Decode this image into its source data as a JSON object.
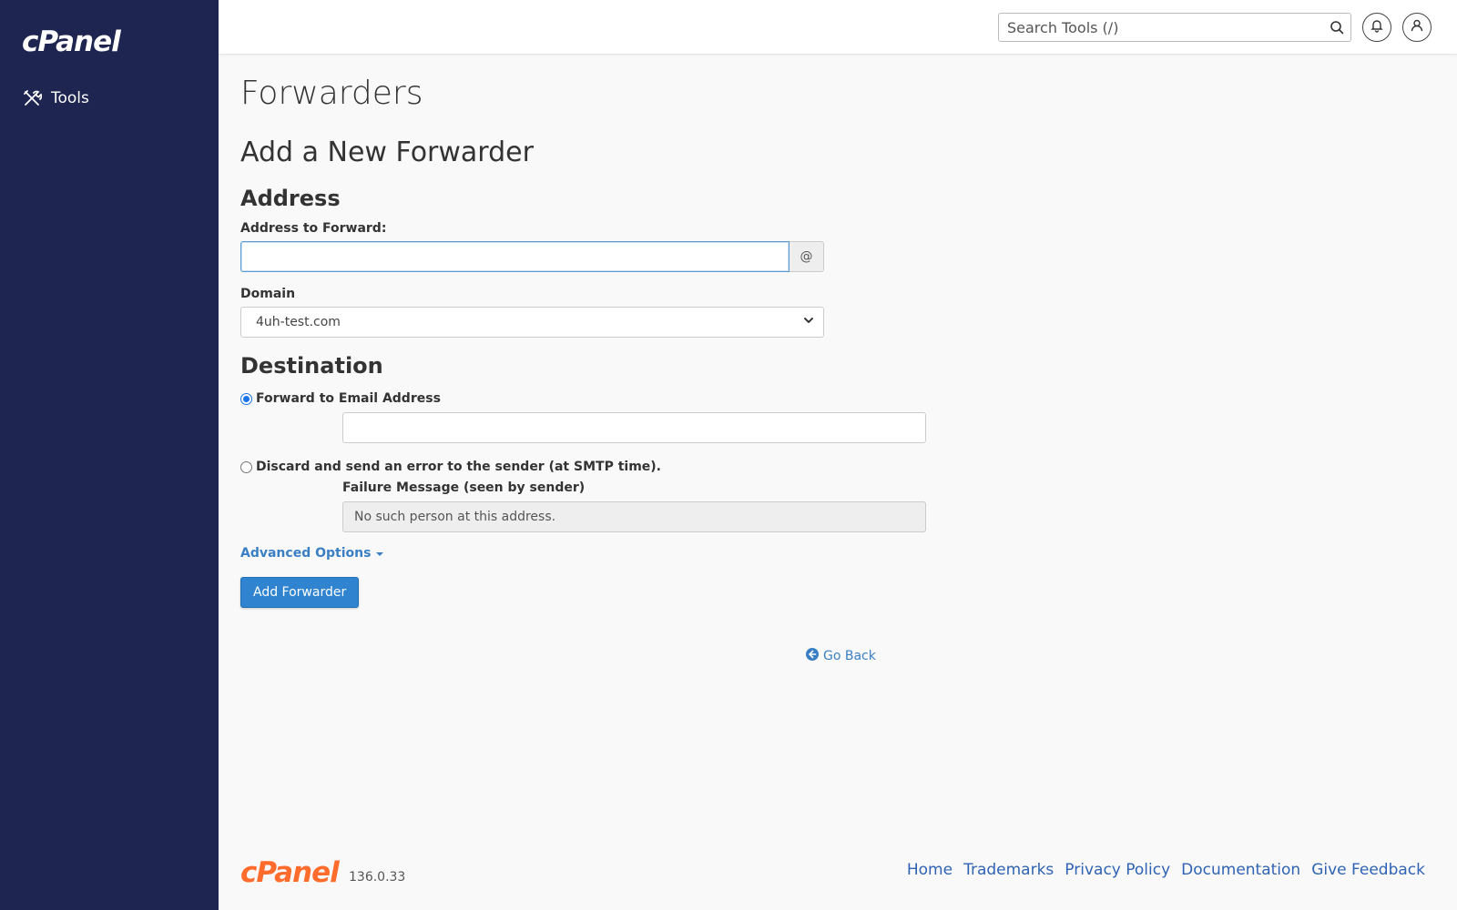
{
  "sidebar": {
    "logo": "cPanel",
    "items": [
      {
        "label": "Tools",
        "icon": "tools-icon"
      }
    ]
  },
  "topbar": {
    "search_placeholder": "Search Tools (/)",
    "search_icon": "search-icon",
    "bell_icon": "bell-icon",
    "user_icon": "user-icon"
  },
  "page": {
    "title": "Forwarders",
    "section_title": "Add a New Forwarder",
    "address": {
      "heading": "Address",
      "forward_label": "Address to Forward:",
      "forward_value": "",
      "at_symbol": "@",
      "domain_label": "Domain",
      "domain_selected": "4uh-test.com"
    },
    "destination": {
      "heading": "Destination",
      "forward_option": "Forward to Email Address",
      "forward_checked": true,
      "email_value": "",
      "discard_option": "Discard and send an error to the sender (at SMTP time).",
      "discard_checked": false,
      "failure_label": "Failure Message (seen by sender)",
      "failure_value": "No such person at this address."
    },
    "advanced_options": "Advanced Options",
    "add_button": "Add Forwarder",
    "go_back": "Go Back"
  },
  "footer": {
    "logo": "cPanel",
    "version": "136.0.33",
    "links": [
      "Home",
      "Trademarks",
      "Privacy Policy",
      "Documentation",
      "Give Feedback"
    ]
  },
  "colors": {
    "sidebar_bg": "#1f2551",
    "accent": "#2f83cf",
    "link": "#3a7fc4",
    "brand_orange": "#ff6c2c"
  }
}
